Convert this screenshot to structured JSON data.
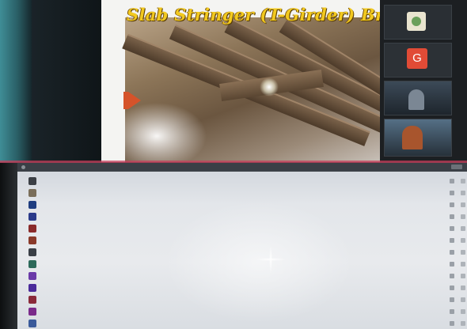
{
  "slide": {
    "title": "Slab Stringer (T-Girder) Bridge"
  },
  "video_tiles": [
    {
      "icon": "profile-picture"
    },
    {
      "avatar_letter": "G"
    },
    {
      "icon": "participant-video"
    },
    {
      "icon": "participant-video"
    }
  ],
  "participants_panel": {
    "rows": [
      {
        "avatar_color": "#3b3f45"
      },
      {
        "avatar_color": "#7a6e5a"
      },
      {
        "avatar_color": "#1f3d80"
      },
      {
        "avatar_color": "#2b3a8a"
      },
      {
        "avatar_color": "#8a2a2a"
      },
      {
        "avatar_color": "#8a3a2a"
      },
      {
        "avatar_color": "#3a3f46"
      },
      {
        "avatar_color": "#2d6a5a"
      },
      {
        "avatar_color": "#6a3aa8"
      },
      {
        "avatar_color": "#4a2a9a"
      },
      {
        "avatar_color": "#8a2a3a"
      },
      {
        "avatar_color": "#7a2a8a"
      },
      {
        "avatar_color": "#3a5a9a"
      }
    ]
  },
  "colors": {
    "title_gold": "#f2c91f",
    "arrow_orange": "#d5532a",
    "g_avatar_red": "#e14b36"
  }
}
